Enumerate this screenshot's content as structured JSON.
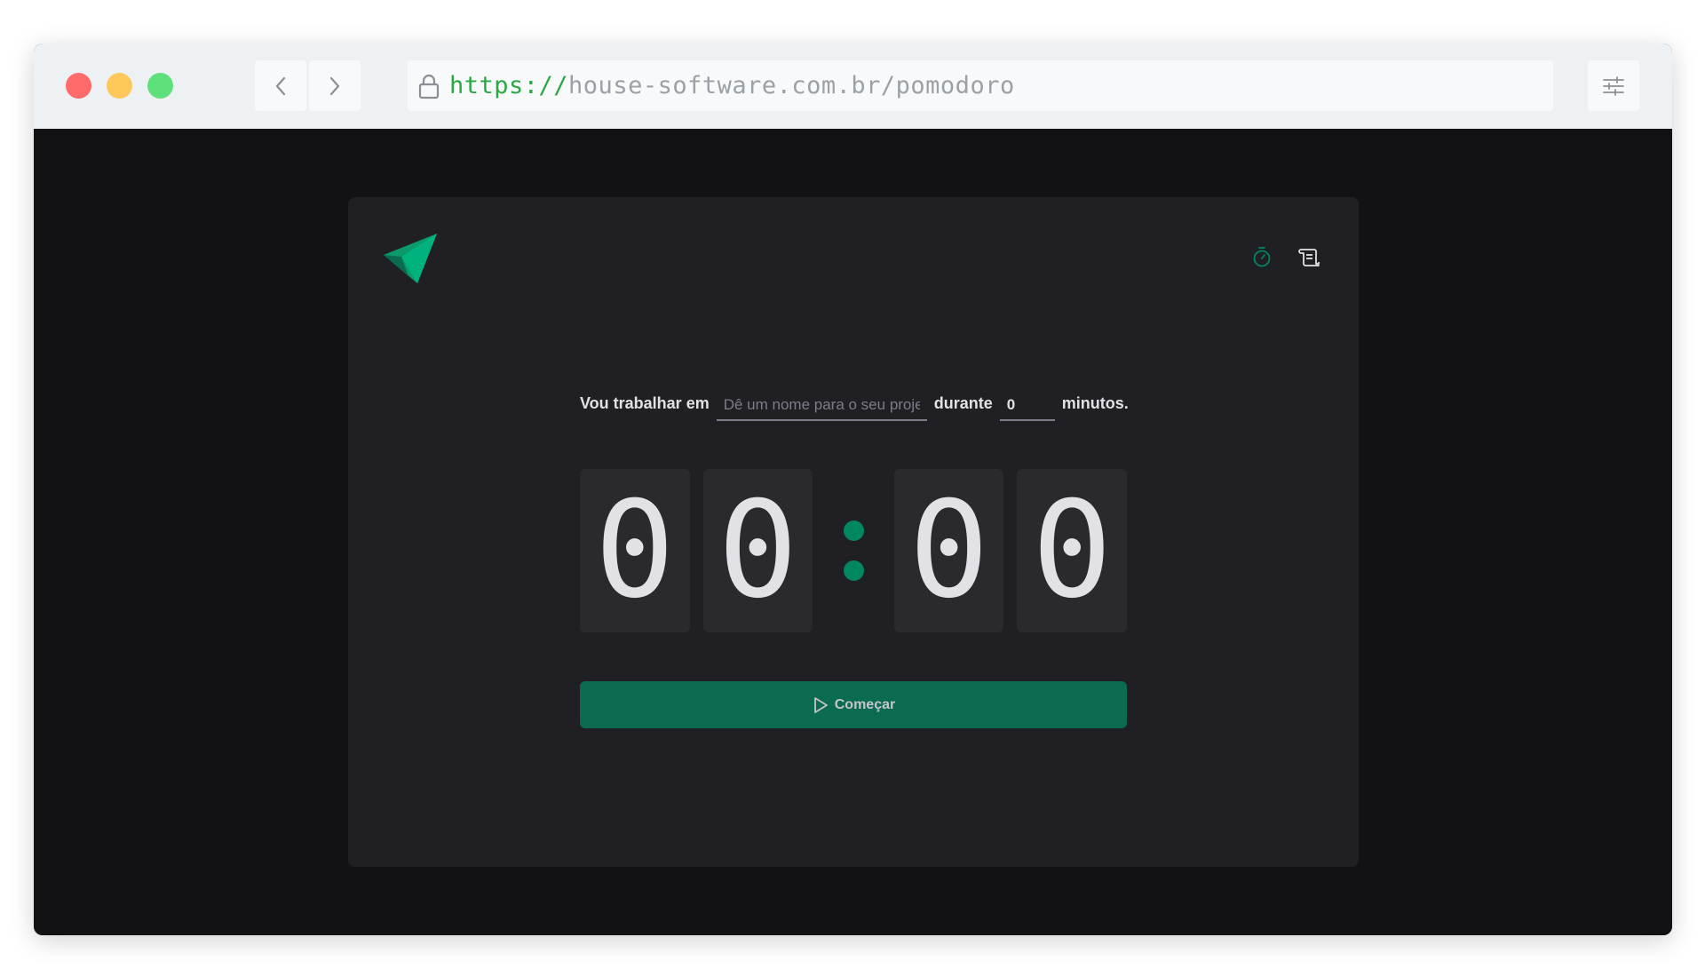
{
  "browser": {
    "url_scheme": "https://",
    "url_rest": "house-software.com.br/pomodoro"
  },
  "header": {
    "logo": "green-triangle-logo",
    "icons": [
      "timer-icon",
      "scroll-history-icon"
    ],
    "accent_color": "#00875f"
  },
  "form": {
    "label_before": "Vou trabalhar em",
    "project_placeholder": "Dê um nome para o seu projeto",
    "project_value": "",
    "label_middle": "durante",
    "minutes_value": "0",
    "label_after": "minutos."
  },
  "countdown": {
    "minutes_tens": "0",
    "minutes_ones": "0",
    "seconds_tens": "0",
    "seconds_ones": "0"
  },
  "start_button": {
    "label": "Começar",
    "icon": "play-icon",
    "color": "#0b6b51"
  }
}
